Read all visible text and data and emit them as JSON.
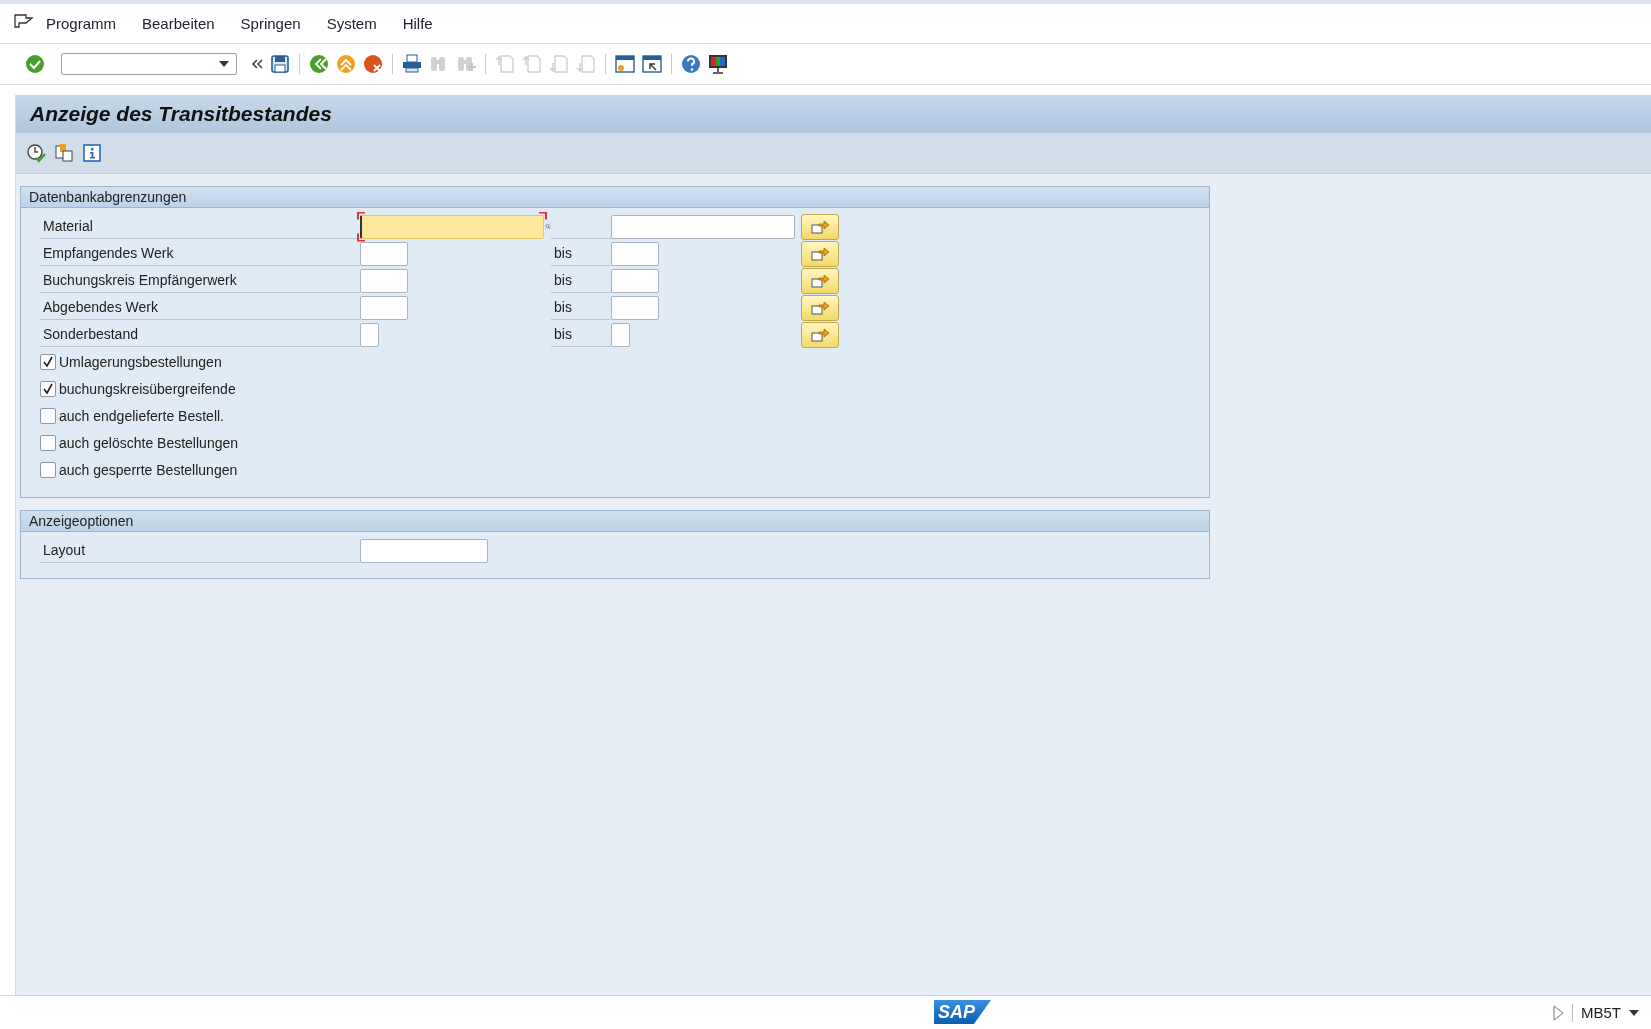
{
  "menu_bar": {
    "items": [
      {
        "label": "Programm"
      },
      {
        "label": "Bearbeiten"
      },
      {
        "label": "Springen"
      },
      {
        "label": "System"
      },
      {
        "label": "Hilfe"
      }
    ]
  },
  "toolbar": [
    {
      "kind": "enter",
      "disabled": false
    },
    {
      "kind": "command"
    },
    {
      "kind": "collapse"
    },
    {
      "kind": "save",
      "disabled": false
    },
    {
      "kind": "separator"
    },
    {
      "kind": "back",
      "disabled": false
    },
    {
      "kind": "exit",
      "disabled": false
    },
    {
      "kind": "cancel",
      "disabled": false
    },
    {
      "kind": "separator"
    },
    {
      "kind": "print",
      "disabled": false
    },
    {
      "kind": "find",
      "disabled": true
    },
    {
      "kind": "find-next",
      "disabled": true
    },
    {
      "kind": "separator"
    },
    {
      "kind": "first-page",
      "disabled": true
    },
    {
      "kind": "prev-page",
      "disabled": true
    },
    {
      "kind": "next-page",
      "disabled": true
    },
    {
      "kind": "last-page",
      "disabled": true
    },
    {
      "kind": "separator"
    },
    {
      "kind": "new-session",
      "disabled": false
    },
    {
      "kind": "shortcut",
      "disabled": false
    },
    {
      "kind": "separator"
    },
    {
      "kind": "help",
      "disabled": false
    },
    {
      "kind": "layout",
      "disabled": false
    }
  ],
  "window": {
    "title": "Anzeige des Transitbestandes"
  },
  "app_toolbar": [
    {
      "kind": "execute"
    },
    {
      "kind": "variants"
    },
    {
      "kind": "info"
    }
  ],
  "groups": [
    {
      "title": "Datenbankabgrenzungen",
      "rows": [
        {
          "kind": "range",
          "label": "Material",
          "focused": true
        },
        {
          "kind": "range",
          "label": "Empfangendes Werk",
          "focused": false,
          "to_label": "bis"
        },
        {
          "kind": "range",
          "label": "Buchungskreis Empfängerwerk",
          "focused": false,
          "to_label": "bis"
        },
        {
          "kind": "range",
          "label": "Abgebendes Werk",
          "focused": false,
          "to_label": "bis"
        },
        {
          "kind": "range",
          "label": "Sonderbestand",
          "focused": false,
          "to_label": "bis"
        },
        {
          "kind": "checkbox",
          "label": "Umlagerungsbestellungen",
          "checked": true
        },
        {
          "kind": "checkbox",
          "label": "buchungskreisübergreifende",
          "checked": true
        },
        {
          "kind": "checkbox",
          "label": "auch endgelieferte Bestell.",
          "checked": false
        },
        {
          "kind": "checkbox",
          "label": "auch gelöschte Bestellungen",
          "checked": false
        },
        {
          "kind": "checkbox",
          "label": "auch gesperrte Bestellungen",
          "checked": false
        }
      ]
    },
    {
      "title": "Anzeigeoptionen",
      "rows": [
        {
          "kind": "parameter",
          "label": "Layout"
        }
      ]
    }
  ],
  "status_bar": {
    "logo": "SAP",
    "transaction": "MB5T"
  }
}
